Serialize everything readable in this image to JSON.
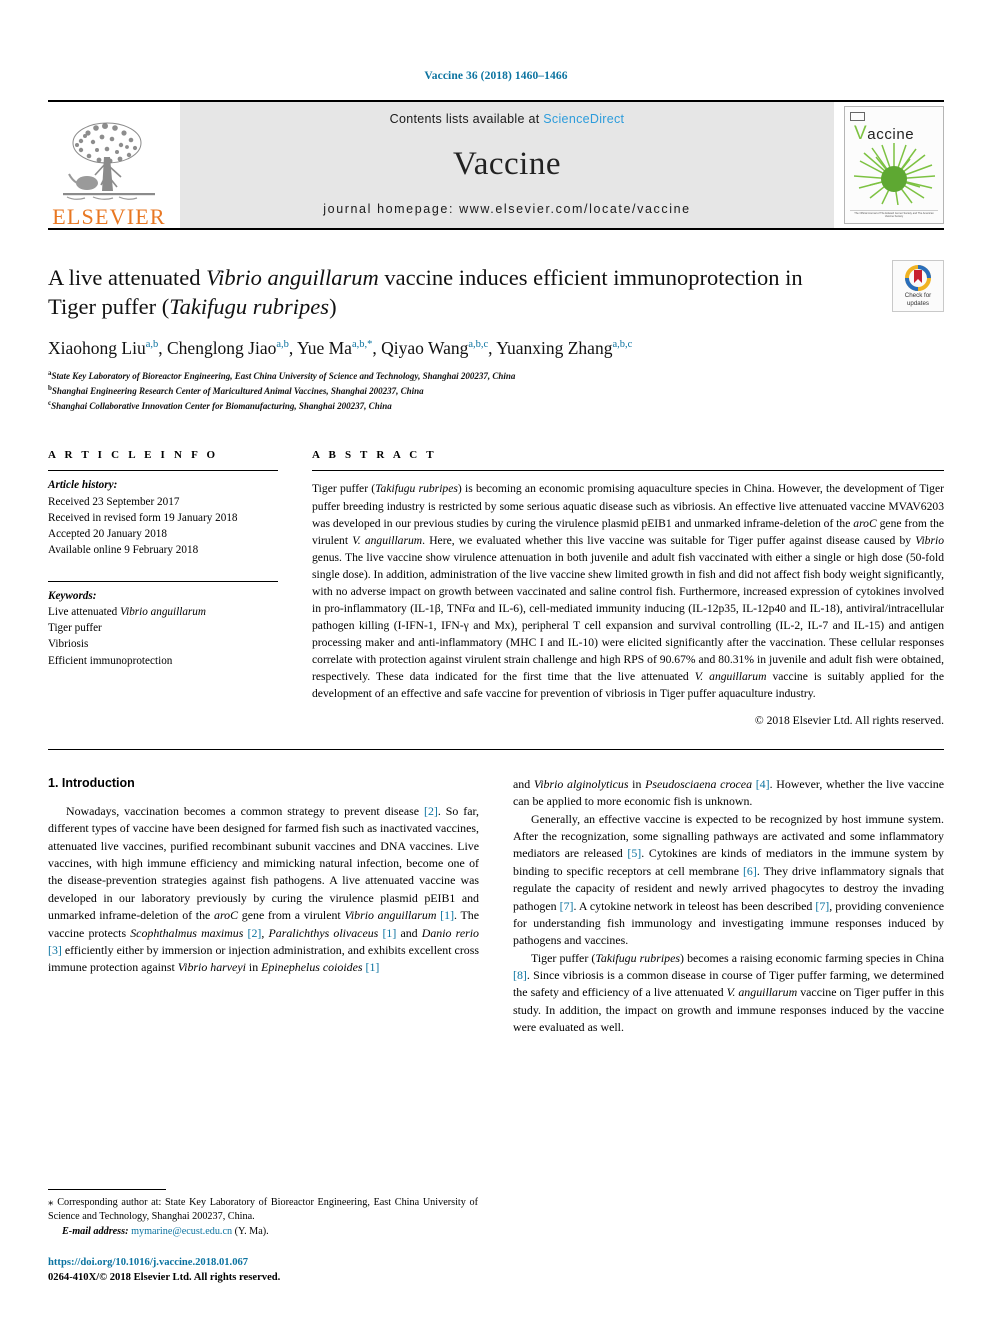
{
  "running_head": "Vaccine 36 (2018) 1460–1466",
  "masthead": {
    "publisher": "ELSEVIER",
    "contents_prefix": "Contents lists available at ",
    "sciencedirect": "ScienceDirect",
    "journal_name": "Vaccine",
    "homepage": "journal homepage: www.elsevier.com/locate/vaccine",
    "cover_title_first": "V",
    "cover_title_rest": "accine",
    "cover_footer": "The Official Journal of The Edward Jenner Society and The American Vaccine Society"
  },
  "article": {
    "title_line1_a": "A live attenuated ",
    "title_line1_i": "Vibrio anguillarum",
    "title_line1_b": " vaccine induces efficient",
    "title_line2_a": "immunoprotection in Tiger puffer (",
    "title_line2_i": "Takifugu rubripes",
    "title_line2_b": ")",
    "authors": [
      {
        "name": "Xiaohong Liu",
        "sup": "a,b",
        "sep": ", "
      },
      {
        "name": "Chenglong Jiao",
        "sup": "a,b",
        "sep": ", "
      },
      {
        "name": "Yue Ma",
        "sup": "a,b,*",
        "sep": ", "
      },
      {
        "name": "Qiyao Wang",
        "sup": "a,b,c",
        "sep": ", "
      },
      {
        "name": "Yuanxing Zhang",
        "sup": "a,b,c",
        "sep": ""
      }
    ],
    "affiliations": [
      {
        "mark": "a",
        "text": "State Key Laboratory of Bioreactor Engineering, East China University of Science and Technology, Shanghai 200237, China"
      },
      {
        "mark": "b",
        "text": "Shanghai Engineering Research Center of Maricultured Animal Vaccines, Shanghai 200237, China"
      },
      {
        "mark": "c",
        "text": "Shanghai Collaborative Innovation Center for Biomanufacturing, Shanghai 200237, China"
      }
    ],
    "crossmark_label": "Check for\nupdates"
  },
  "article_info": {
    "heading": "A R T I C L E   I N F O",
    "history_label": "Article history:",
    "history": [
      "Received 23 September 2017",
      "Received in revised form 19 January 2018",
      "Accepted 20 January 2018",
      "Available online 9 February 2018"
    ],
    "keywords_label": "Keywords:",
    "keywords": [
      "Live attenuated Vibrio anguillarum",
      "Tiger puffer",
      "Vibriosis",
      "Efficient immunoprotection"
    ],
    "keyword_italic_part": "Vibrio anguillarum",
    "keyword_plain_part": "Live attenuated "
  },
  "abstract": {
    "heading": "A B S T R A C T",
    "p1_a": "Tiger puffer (",
    "p1_i1": "Takifugu rubripes",
    "p1_b": ") is becoming an economic promising aquaculture species in China. However, the development of Tiger puffer breeding industry is restricted by some serious aquatic disease such as vibriosis. An effective live attenuated vaccine MVAV6203 was developed in our previous studies by curing the virulence plasmid pEIB1 and unmarked inframe-deletion of the ",
    "p1_i2": "aroC",
    "p1_c": " gene from the virulent ",
    "p1_i3": "V. anguillarum",
    "p1_d": ". Here, we evaluated whether this live vaccine was suitable for Tiger puffer against disease caused by ",
    "p1_i4": "Vibrio",
    "p1_e": " genus. The live vaccine show virulence attenuation in both juvenile and adult fish vaccinated with either a single or high dose (50-fold single dose). In addition, administration of the live vaccine shew limited growth in fish and did not affect fish body weight significantly, with no adverse impact on growth between vaccinated and saline control fish. Furthermore, increased expression of cytokines involved in pro-inflammatory (IL-1β, TNFα and IL-6), cell-mediated immunity inducing (IL-12p35, IL-12p40 and IL-18), antiviral/intracellular pathogen killing (I-IFN-1, IFN-γ and Mx), peripheral T cell expansion and survival controlling (IL-2, IL-7 and IL-15) and antigen processing maker and anti-inflammatory (MHC I and IL-10) were elicited significantly after the vaccination. These cellular responses correlate with protection against virulent strain challenge and high RPS of 90.67% and 80.31% in juvenile and adult fish were obtained, respectively. These data indicated for the first time that the live attenuated ",
    "p1_i5": "V. anguillarum",
    "p1_f": " vaccine is suitably applied for the development of an effective and safe vaccine for prevention of vibriosis in Tiger puffer aquaculture industry.",
    "copyright": "© 2018 Elsevier Ltd. All rights reserved."
  },
  "introduction": {
    "heading": "1. Introduction",
    "left_p1_a": "Nowadays, vaccination becomes a common strategy to prevent disease ",
    "left_p1_r1": "[2]",
    "left_p1_b": ". So far, different types of vaccine have been designed for farmed fish such as inactivated vaccines, attenuated live vaccines, purified recombinant subunit vaccines and DNA vaccines. Live vaccines, with high immune efficiency and mimicking natural infection, become one of the disease-prevention strategies against fish pathogens. A live attenuated vaccine was developed in our laboratory previously by curing the virulence plasmid pEIB1 and unmarked inframe-deletion of the ",
    "left_p1_i1": "aroC",
    "left_p1_c": " gene from a virulent ",
    "left_p1_i2": "Vibrio anguillarum",
    "left_p1_d": " ",
    "left_p1_r2": "[1]",
    "left_p1_e": ". The vaccine protects ",
    "left_p1_i3": "Scophthalmus maximus",
    "left_p1_f": " ",
    "left_p1_r3": "[2]",
    "left_p1_g": ", ",
    "left_p1_i4": "Paralichthys olivaceus",
    "left_p1_h": " ",
    "left_p1_r4": "[1]",
    "left_p1_j": " and ",
    "left_p1_i5": "Danio rerio",
    "left_p1_k": " ",
    "left_p1_r5": "[3]",
    "left_p1_l": " efficiently either by immersion or injection administration, and exhibits excellent cross immune protection against ",
    "left_p1_i6": "Vibrio harveyi",
    "left_p1_m": " in ",
    "left_p1_i7": "Epinephelus coioides",
    "left_p1_n": " ",
    "left_p1_r6": "[1]",
    "right_p1_a": "and ",
    "right_p1_i1": "Vibrio alginolyticus",
    "right_p1_b": " in ",
    "right_p1_i2": "Pseudosciaena crocea",
    "right_p1_c": " ",
    "right_p1_r1": "[4]",
    "right_p1_d": ". However, whether the live vaccine can be applied to more economic fish is unknown.",
    "right_p2_a": "Generally, an effective vaccine is expected to be recognized by host immune system. After the recognization, some signalling pathways are activated and some inflammatory mediators are released ",
    "right_p2_r1": "[5]",
    "right_p2_b": ". Cytokines are kinds of mediators in the immune system by binding to specific receptors at cell membrane ",
    "right_p2_r2": "[6]",
    "right_p2_c": ". They drive inflammatory signals that regulate the capacity of resident and newly arrived phagocytes to destroy the invading pathogen ",
    "right_p2_r3": "[7]",
    "right_p2_d": ". A cytokine network in teleost has been described ",
    "right_p2_r4": "[7]",
    "right_p2_e": ", providing convenience for understanding fish immunology and investigating immune responses induced by pathogens and vaccines.",
    "right_p3_a": "Tiger puffer (",
    "right_p3_i1": "Takifugu rubripes",
    "right_p3_b": ") becomes a raising economic farming species in China ",
    "right_p3_r1": "[8]",
    "right_p3_c": ". Since vibriosis is a common disease in course of Tiger puffer farming, we determined the safety and efficiency of a live attenuated ",
    "right_p3_i2": "V. anguillarum",
    "right_p3_d": " vaccine on Tiger puffer in this study. In addition, the impact on growth and immune responses induced by the vaccine were evaluated as well."
  },
  "footnote": {
    "star": "⁎",
    "corresponding": " Corresponding author at: State Key Laboratory of Bioreactor Engineering, East China University of Science and Technology, Shanghai 200237, China.",
    "email_label": "E-mail address:",
    "email": "mymarine@ecust.edu.cn",
    "email_suffix": " (Y. Ma).",
    "doi": "https://doi.org/10.1016/j.vaccine.2018.01.067",
    "issn": "0264-410X/© 2018 Elsevier Ltd. All rights reserved."
  },
  "colors": {
    "link": "#0b73a0",
    "sciencedirect": "#2d9cdb",
    "elsevier_orange": "#e87722",
    "cover_green": "#7dc242",
    "banner_gray": "#e6e6e6"
  }
}
